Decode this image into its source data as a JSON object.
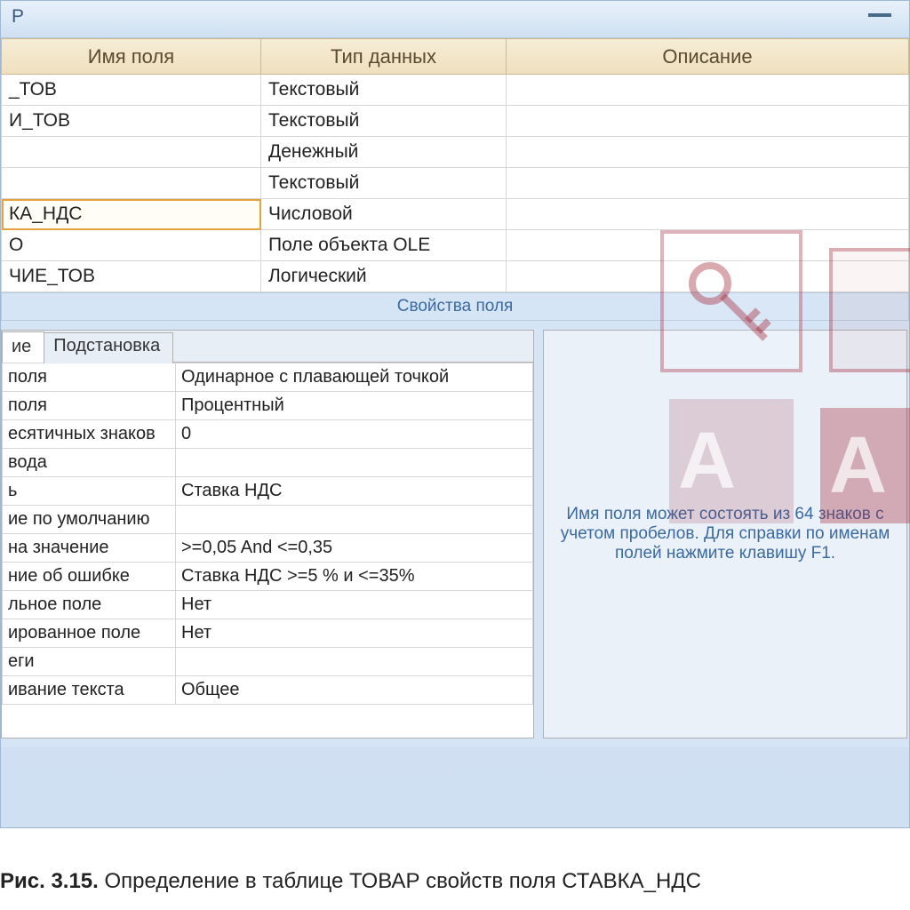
{
  "title_suffix": "Р",
  "columns": {
    "name": "Имя поля",
    "type": "Тип данных",
    "desc": "Описание"
  },
  "fields": [
    {
      "name": "_ТОВ",
      "type": "Текстовый",
      "desc": ""
    },
    {
      "name": "И_ТОВ",
      "type": "Текстовый",
      "desc": ""
    },
    {
      "name": "",
      "type": "Денежный",
      "desc": ""
    },
    {
      "name": "",
      "type": "Текстовый",
      "desc": ""
    },
    {
      "name": "КА_НДС",
      "type": "Числовой",
      "desc": "",
      "selected": true
    },
    {
      "name": "О",
      "type": "Поле объекта OLE",
      "desc": ""
    },
    {
      "name": "ЧИЕ_ТОВ",
      "type": "Логический",
      "desc": ""
    }
  ],
  "section_label": "Свойства поля",
  "tabs": {
    "general": "ие",
    "lookup": "Подстановка"
  },
  "properties": [
    {
      "label": "поля",
      "value": "Одинарное с плавающей точкой"
    },
    {
      "label": "поля",
      "value": "Процентный"
    },
    {
      "label": "есятичных знаков",
      "value": "0"
    },
    {
      "label": "вода",
      "value": ""
    },
    {
      "label": "ь",
      "value": "Ставка НДС"
    },
    {
      "label": "ие по умолчанию",
      "value": ""
    },
    {
      "label": " на значение",
      "value": ">=0,05 And <=0,35"
    },
    {
      "label": "ние об ошибке",
      "value": "Ставка НДС >=5 % и <=35%"
    },
    {
      "label": "льное поле",
      "value": "Нет"
    },
    {
      "label": "ированное поле",
      "value": "Нет"
    },
    {
      "label": "еги",
      "value": ""
    },
    {
      "label": "ивание текста",
      "value": "Общее"
    }
  ],
  "help_text": "Имя поля может состоять из 64 знаков с учетом пробелов. Для справки по именам полей нажмите клавишу F1.",
  "caption_bold": "Рис. 3.15.",
  "caption_text": " Определение в таблице ТОВАР свойств поля СТАВКА_НДС"
}
